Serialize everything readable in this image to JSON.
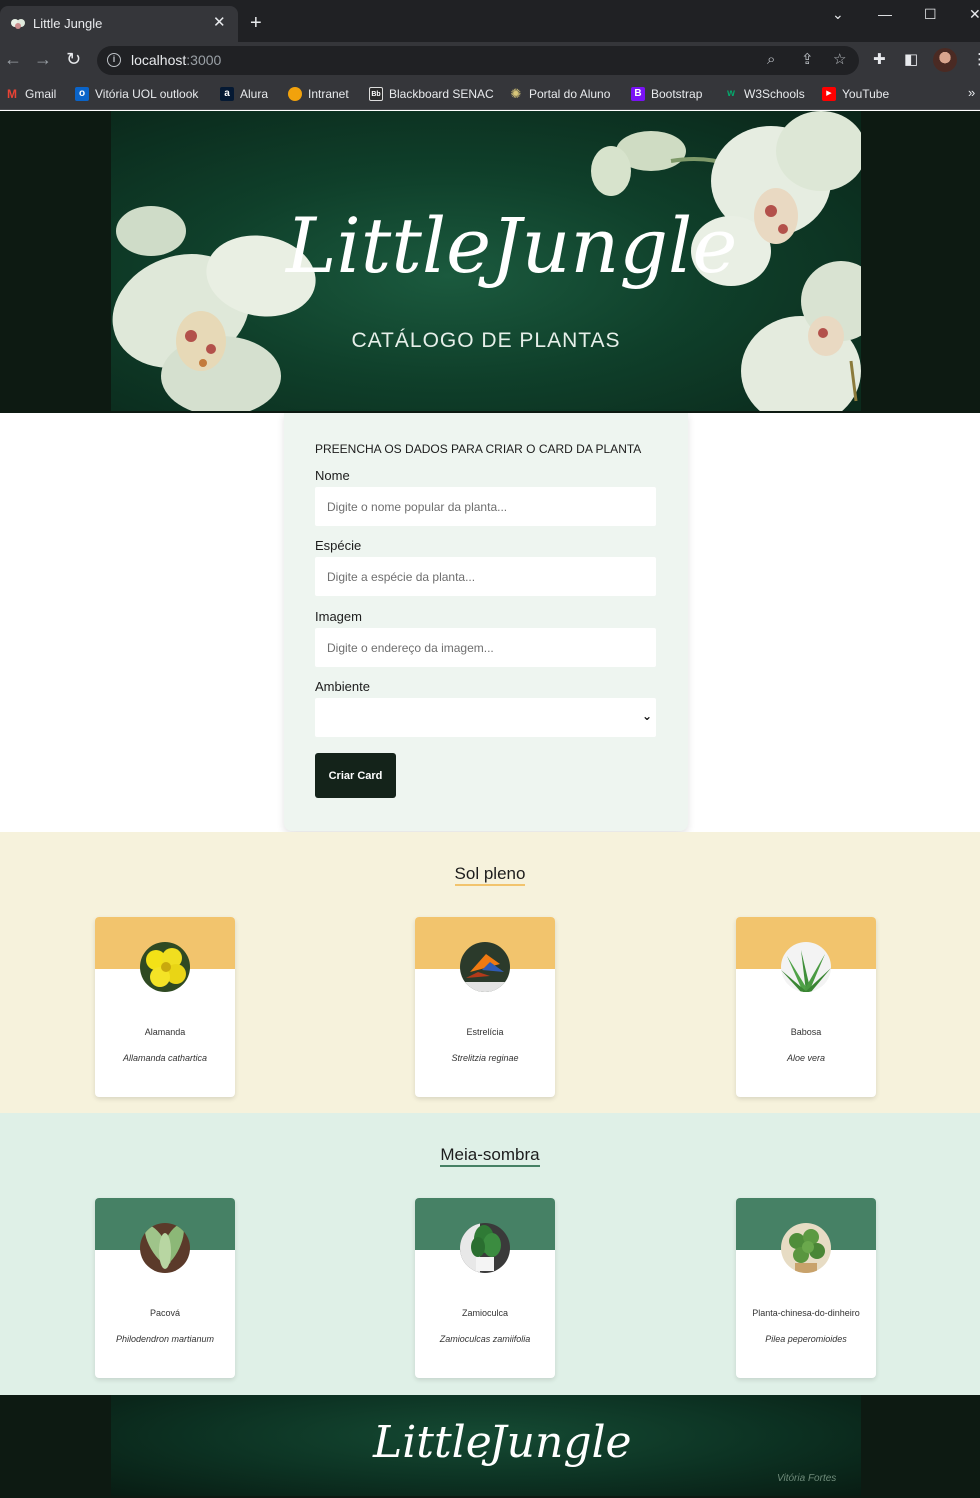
{
  "browser": {
    "tab_title": "Little Jungle",
    "url_host": "localhost",
    "url_port": ":3000",
    "bookmarks": [
      {
        "label": "Gmail",
        "icon": "gmail-icon",
        "color": "#ea4335"
      },
      {
        "label": "Vitória UOL outlook",
        "icon": "outlook-icon",
        "color": "#0a64c9"
      },
      {
        "label": "Alura",
        "icon": "alura-icon",
        "color": "#051933"
      },
      {
        "label": "Intranet",
        "icon": "intranet-icon",
        "color": "#f2a20c"
      },
      {
        "label": "Blackboard SENAC",
        "icon": "blackboard-icon",
        "color": "#2b2b2b"
      },
      {
        "label": "Portal do Aluno",
        "icon": "portal-icon",
        "color": "#d8c77a"
      },
      {
        "label": "Bootstrap",
        "icon": "bootstrap-icon",
        "color": "#7a12f5"
      },
      {
        "label": "W3Schools",
        "icon": "w3schools-icon",
        "color": "#04aa6d"
      },
      {
        "label": "YouTube",
        "icon": "youtube-icon",
        "color": "#ff0000"
      }
    ]
  },
  "hero": {
    "brand_word1": "Little",
    "brand_word2": "Jungle",
    "subtitle": "CATÁLOGO DE PLANTAS"
  },
  "form": {
    "heading": "PREENCHA OS DADOS PARA CRIAR O CARD DA PLANTA",
    "fields": [
      {
        "label": "Nome",
        "placeholder": "Digite o nome popular da planta..."
      },
      {
        "label": "Espécie",
        "placeholder": "Digite a espécie da planta..."
      },
      {
        "label": "Imagem",
        "placeholder": "Digite o endereço da imagem..."
      }
    ],
    "select_label": "Ambiente",
    "select_value": "",
    "submit_label": "Criar Card"
  },
  "sections": [
    {
      "title": "Sol pleno",
      "background": "#f6f2dc",
      "accent": "#f2c46d",
      "plants": [
        {
          "name": "Alamanda",
          "species": "Allamanda cathartica",
          "photo": "yellow-flower"
        },
        {
          "name": "Estrelícia",
          "species": "Strelitzia reginae",
          "photo": "bird-of-paradise"
        },
        {
          "name": "Babosa",
          "species": "Aloe vera",
          "photo": "aloe"
        }
      ]
    },
    {
      "title": "Meia-sombra",
      "background": "#dff0e7",
      "accent": "#468165",
      "plants": [
        {
          "name": "Pacová",
          "species": "Philodendron martianum",
          "photo": "pacova"
        },
        {
          "name": "Zamioculca",
          "species": "Zamioculcas zamiifolia",
          "photo": "zamioculca"
        },
        {
          "name": "Planta-chinesa-do-dinheiro",
          "species": "Pilea peperomioides",
          "photo": "pilea"
        }
      ]
    }
  ],
  "footer": {
    "brand_word1": "Little",
    "brand_word2": "Jungle",
    "credit": "Vitória Fortes"
  }
}
